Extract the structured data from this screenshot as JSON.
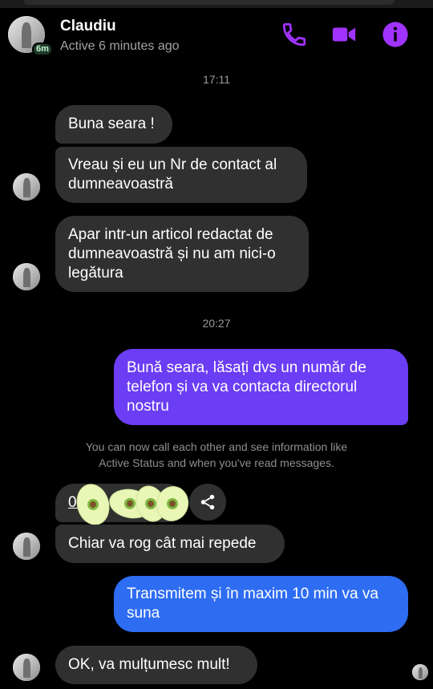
{
  "header": {
    "contact_name": "Claudiu",
    "active_status": "Active 6 minutes ago",
    "active_badge": "6m",
    "icons": [
      "phone-icon",
      "video-camera-icon",
      "info-icon"
    ],
    "accent_color": "#a033ff"
  },
  "timestamps": [
    "17:11",
    "20:27"
  ],
  "messages": [
    {
      "side": "incoming",
      "text": "Buna seara !"
    },
    {
      "side": "incoming",
      "text": "Vreau și eu un Nr de contact al dumneavoastră"
    },
    {
      "side": "incoming",
      "text": "Apar intr-un articol redactat de dumneavoastră și nu am nici-o legătura"
    },
    {
      "side": "outgoing",
      "text": "Bună seara, lăsați dvs un număr de telefon și va va contacta directorul nostru",
      "color": "#6b3df4"
    },
    {
      "side": "incoming",
      "text": "Chiar va rog cât mai repede"
    },
    {
      "side": "outgoing",
      "text": "Transmitem și în maxim 10 min va va suna",
      "color": "#2e6cf2"
    },
    {
      "side": "incoming",
      "text": "OK, va mulțumesc mult!"
    }
  ],
  "system_message": {
    "line1": "You can now call each other and see information like",
    "line2": "Active Status and when you've read messages."
  },
  "phone_bubble": {
    "visible_start": "07",
    "visible_mid": "5",
    "share_icon": "share-icon"
  }
}
